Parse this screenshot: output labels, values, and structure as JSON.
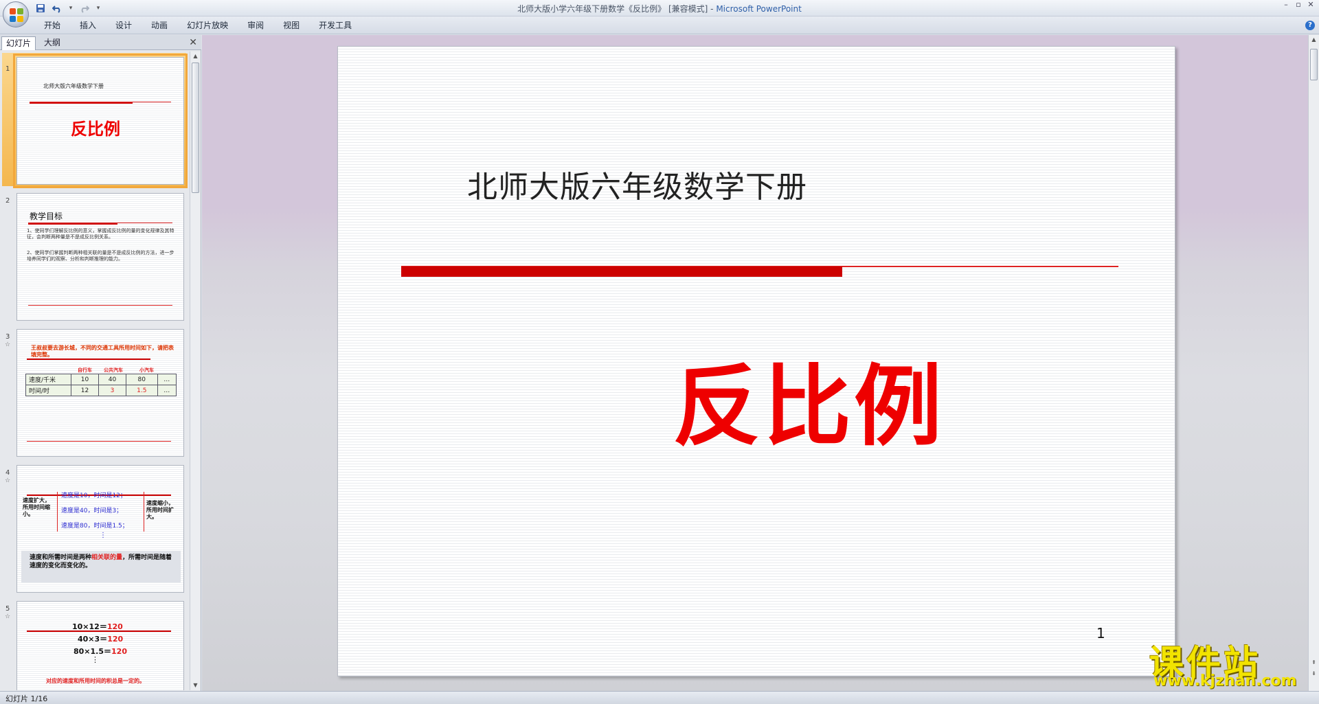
{
  "window": {
    "title_doc": "北师大版小学六年级下册数学《反比例》 [兼容模式] - ",
    "title_app": "Microsoft PowerPoint"
  },
  "ribbon": {
    "tabs": [
      "开始",
      "插入",
      "设计",
      "动画",
      "幻灯片放映",
      "审阅",
      "视图",
      "开发工具"
    ]
  },
  "panel": {
    "tab_slides": "幻灯片",
    "tab_outline": "大纲"
  },
  "thumbs": {
    "t1": {
      "num": "1",
      "subtitle": "北师大版六年级数学下册",
      "title": "反比例"
    },
    "t2": {
      "num": "2",
      "heading": "教学目标",
      "items": [
        "1、使同学们理解反比例的意义，掌握成反比例的量的变化规律及其特征，会判断两种量是不是成反比例关系。",
        "2、使同学们掌握判断两种相关联的量是不是成反比例的方法，进一步培养同学们的观察、分析和判断推理的能力。"
      ]
    },
    "t3": {
      "num": "3",
      "heading": "王叔叔要去游长城，不同的交通工具所用时间如下，请把表填完整。",
      "cols": [
        "自行车",
        "公共汽车",
        "小汽车"
      ],
      "row1": [
        "速度/千米",
        "10",
        "40",
        "80",
        "…"
      ],
      "row2": [
        "时间/时",
        "12",
        "3",
        "1.5",
        "…"
      ]
    },
    "t4": {
      "num": "4",
      "left": "速度扩大，所用时间缩小。",
      "lines": [
        "速度是10，时间是12；",
        "速度是40，时间是3；",
        "速度是80，时间是1.5；"
      ],
      "right": "速度缩小，所用时间扩大。",
      "summary_a": "速度和所需时间是两种",
      "summary_hl": "相关联的量",
      "summary_b": "，所需时间是随着速度的变化而变化的。"
    },
    "t5": {
      "num": "5",
      "eq1": "10×12＝",
      "eq2": "40×3＝",
      "eq3": "80×1.5＝",
      "result": "120",
      "note": "对应的速度和所用时间的积总是一定的。"
    }
  },
  "slide": {
    "subtitle": "北师大版六年级数学下册",
    "title": "反比例",
    "number": "1"
  },
  "status": {
    "text": "幻灯片 1/16"
  },
  "watermark": {
    "cn": "课件站",
    "url": "www.kjzhan.com"
  }
}
